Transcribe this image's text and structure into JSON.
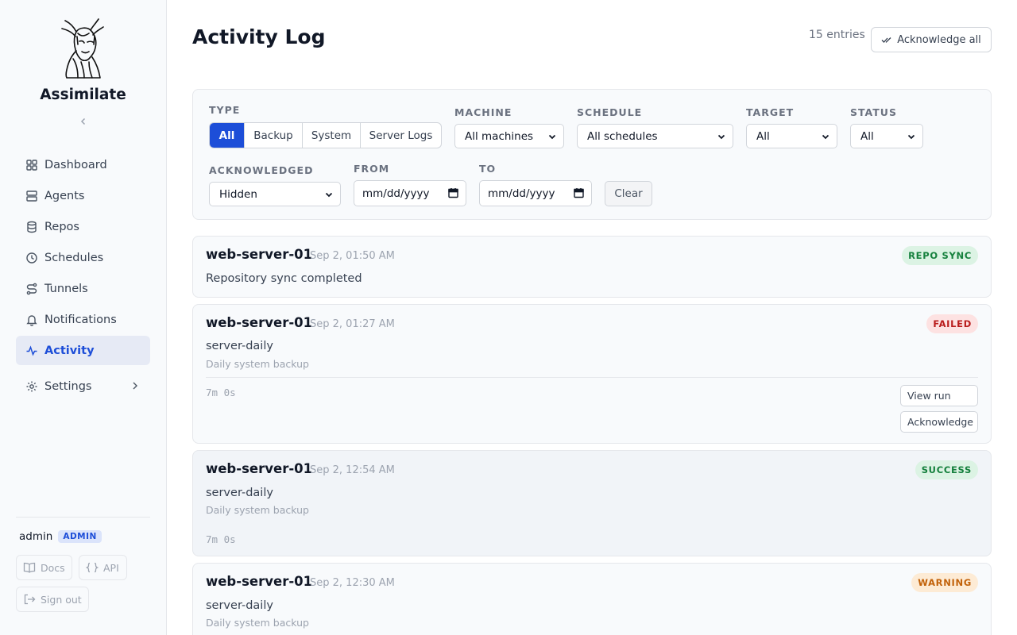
{
  "app": {
    "brand": "Assimilate"
  },
  "sidebar": {
    "items": [
      {
        "label": "Dashboard",
        "icon": "grid-icon"
      },
      {
        "label": "Agents",
        "icon": "server-icon"
      },
      {
        "label": "Repos",
        "icon": "database-icon"
      },
      {
        "label": "Schedules",
        "icon": "clock-icon"
      },
      {
        "label": "Tunnels",
        "icon": "route-icon"
      },
      {
        "label": "Notifications",
        "icon": "bell-icon"
      },
      {
        "label": "Activity",
        "icon": "activity-icon",
        "active": true
      },
      {
        "label": "Settings",
        "icon": "gear-icon"
      }
    ],
    "user": {
      "name": "admin",
      "role": "ADMIN"
    },
    "docs_label": "Docs",
    "api_label": "API",
    "signout_label": "Sign out"
  },
  "header": {
    "title": "Activity Log",
    "entry_count": "15 entries",
    "ack_all_label": "Acknowledge all"
  },
  "filters": {
    "type_label": "TYPE",
    "type_options": [
      "All",
      "Backup",
      "System",
      "Server Logs"
    ],
    "type_selected": "All",
    "machine_label": "MACHINE",
    "machine_value": "All machines",
    "schedule_label": "SCHEDULE",
    "schedule_value": "All schedules",
    "target_label": "TARGET",
    "target_value": "All",
    "status_label": "STATUS",
    "status_value": "All",
    "ack_label": "ACKNOWLEDGED",
    "ack_value": "Hidden",
    "from_label": "FROM",
    "from_placeholder": "mm/dd/yyyy",
    "to_label": "TO",
    "to_placeholder": "mm/dd/yyyy",
    "clear_label": "Clear"
  },
  "entries": [
    {
      "machine": "web-server-01",
      "time": "Sep 2, 01:50 AM",
      "status": "REPO SYNC",
      "message": "Repository sync completed"
    },
    {
      "machine": "web-server-01",
      "time": "Sep 2, 01:27 AM",
      "status": "FAILED",
      "message": "server-daily",
      "description": "Daily system backup",
      "duration": "7m 0s",
      "view_label": "View run",
      "ack_label": "Acknowledge"
    },
    {
      "machine": "web-server-01",
      "time": "Sep 2, 12:54 AM",
      "status": "SUCCESS",
      "message": "server-daily",
      "description": "Daily system backup",
      "duration": "7m 0s"
    },
    {
      "machine": "web-server-01",
      "time": "Sep 2, 12:30 AM",
      "status": "WARNING",
      "message": "server-daily",
      "description": "Daily system backup"
    }
  ],
  "colors": {
    "accent": "#1d4ed8",
    "success": "#15803d",
    "failed": "#b91c1c",
    "warning": "#c2620a"
  }
}
